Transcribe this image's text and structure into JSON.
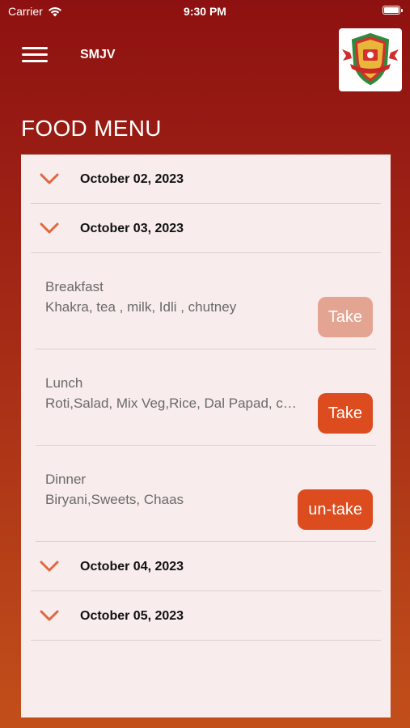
{
  "status_bar": {
    "carrier": "Carrier",
    "time": "9:30 PM"
  },
  "header": {
    "app_name": "SMJV"
  },
  "page": {
    "title": "FOOD MENU"
  },
  "days": [
    {
      "date": "October 02, 2023"
    },
    {
      "date": "October 03, 2023"
    }
  ],
  "meals": [
    {
      "name": "Breakfast",
      "items": "Khakra, tea , milk, Idli , chutney",
      "button": "Take",
      "state": "disabled"
    },
    {
      "name": "Lunch",
      "items": "Roti,Salad, Mix Veg,Rice, Dal Papad, c…",
      "button": "Take",
      "state": "active"
    },
    {
      "name": "Dinner",
      "items": "Biryani,Sweets, Chaas",
      "button": "un-take",
      "state": "active"
    }
  ],
  "more_days": [
    {
      "date": "October 04, 2023"
    },
    {
      "date": "October 05, 2023"
    }
  ],
  "colors": {
    "chevron": "#e0673f",
    "button_active": "#dc4c1e",
    "button_disabled": "#e4a492"
  }
}
